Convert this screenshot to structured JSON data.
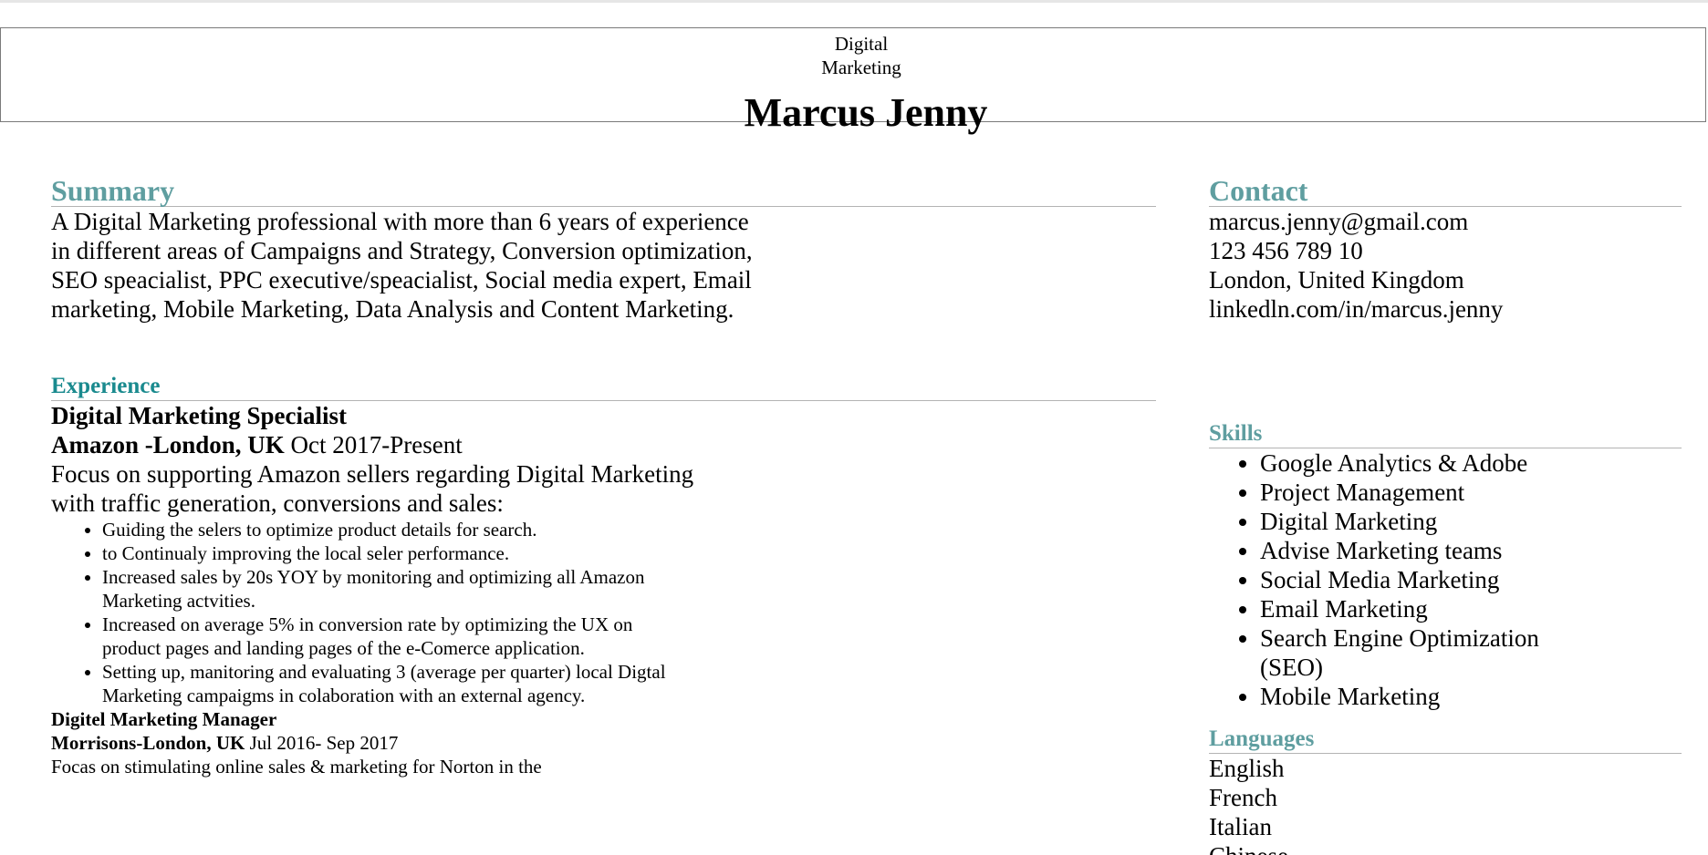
{
  "header": {
    "legend": "Digital Marketing",
    "name": "Marcus Jenny"
  },
  "summary": {
    "title": "Summary",
    "text": "A Digital Marketing professional with more than 6 years of experience in different areas of Campaigns and Strategy, Conversion optimization, SEO speacialist, PPC executive/speacialist, Social media expert, Email marketing, Mobile Marketing, Data Analysis and Content Marketing."
  },
  "experience": {
    "title": "Experience",
    "jobs": [
      {
        "title": "Digital Marketing Specialist",
        "company": "Amazon -London, UK",
        "dates": "Oct 2017-Present",
        "description": "Focus on supporting Amazon sellers regarding Digital Marketing with traffic generation, conversions and sales:",
        "bullets": [
          "Guiding the selers to optimize product details for search.",
          "to Continualy improving the local seler performance.",
          "Increased sales by 20s YOY by monitoring and optimizing all Amazon Marketing actvities.",
          "Increased on average 5% in conversion rate by optimizing the UX on product pages and landing pages of the e-Comerce application.",
          "Setting up, manitoring and evaluating 3 (average per quarter) local Digtal Marketing campaigms in colaboration with an external agency."
        ]
      },
      {
        "title": "Digitel Marketing Manager",
        "company": "Morrisons-London, UK",
        "dates": "Jul 2016- Sep 2017",
        "description": "Focas on stimulating online sales & marketing for Norton in the"
      }
    ]
  },
  "contact": {
    "title": "Contact",
    "email": "marcus.jenny@gmail.com",
    "phone": "123 456 789 10",
    "location": "London, United Kingdom",
    "linkedin": "linkedln.com/in/marcus.jenny"
  },
  "skills": {
    "title": "Skills",
    "items": [
      "Google Analytics & Adobe",
      "Project Management",
      "Digital Marketing",
      "Advise Marketing teams",
      "Social Media Marketing",
      "Email Marketing",
      "Search Engine Optimization (SEO)",
      "Mobile Marketing"
    ]
  },
  "languages": {
    "title": "Languages",
    "items": [
      "English",
      "French",
      "Italian",
      "Chinese"
    ]
  },
  "colors": {
    "section_heading": "#5f9ea0",
    "experience_heading": "#1a8a8e",
    "rule": "#b3b3b3"
  }
}
